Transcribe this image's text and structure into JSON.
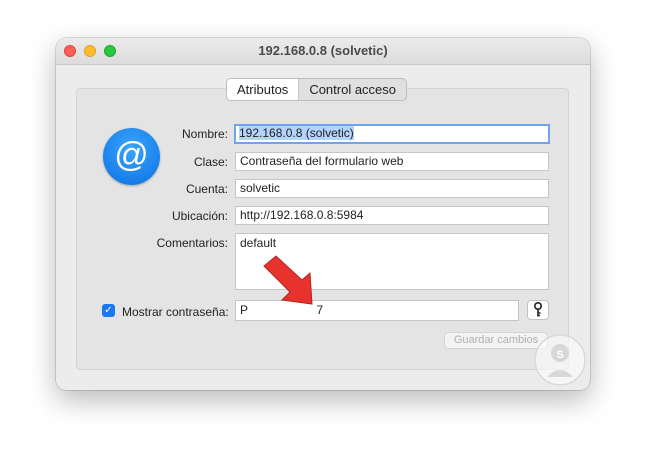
{
  "window": {
    "title": "192.168.0.8 (solvetic)"
  },
  "tabs": [
    {
      "label": "Atributos",
      "active": true
    },
    {
      "label": "Control acceso",
      "active": false
    }
  ],
  "app_icon": {
    "icon": "at-sign-icon",
    "glyph": "@",
    "color": "#0a84ff"
  },
  "form": {
    "nombre_label": "Nombre:",
    "nombre_value": "192.168.0.8 (solvetic)",
    "clase_label": "Clase:",
    "clase_value": "Contraseña del formulario web",
    "cuenta_label": "Cuenta:",
    "cuenta_value": "solvetic",
    "ubicacion_label": "Ubicación:",
    "ubicacion_value": "http://192.168.0.8:5984",
    "comentarios_label": "Comentarios:",
    "comentarios_value": "default",
    "mostrar_label": "Mostrar contraseña:",
    "mostrar_checked": true,
    "password_visible_start": "P",
    "password_visible_end": "7",
    "save_label": "Guardar cambios"
  },
  "colors": {
    "accent": "#1a78f2",
    "annotation_arrow": "#e8322e",
    "close": "#fe5f57",
    "minimize": "#febc2e",
    "maximize": "#28c840"
  }
}
